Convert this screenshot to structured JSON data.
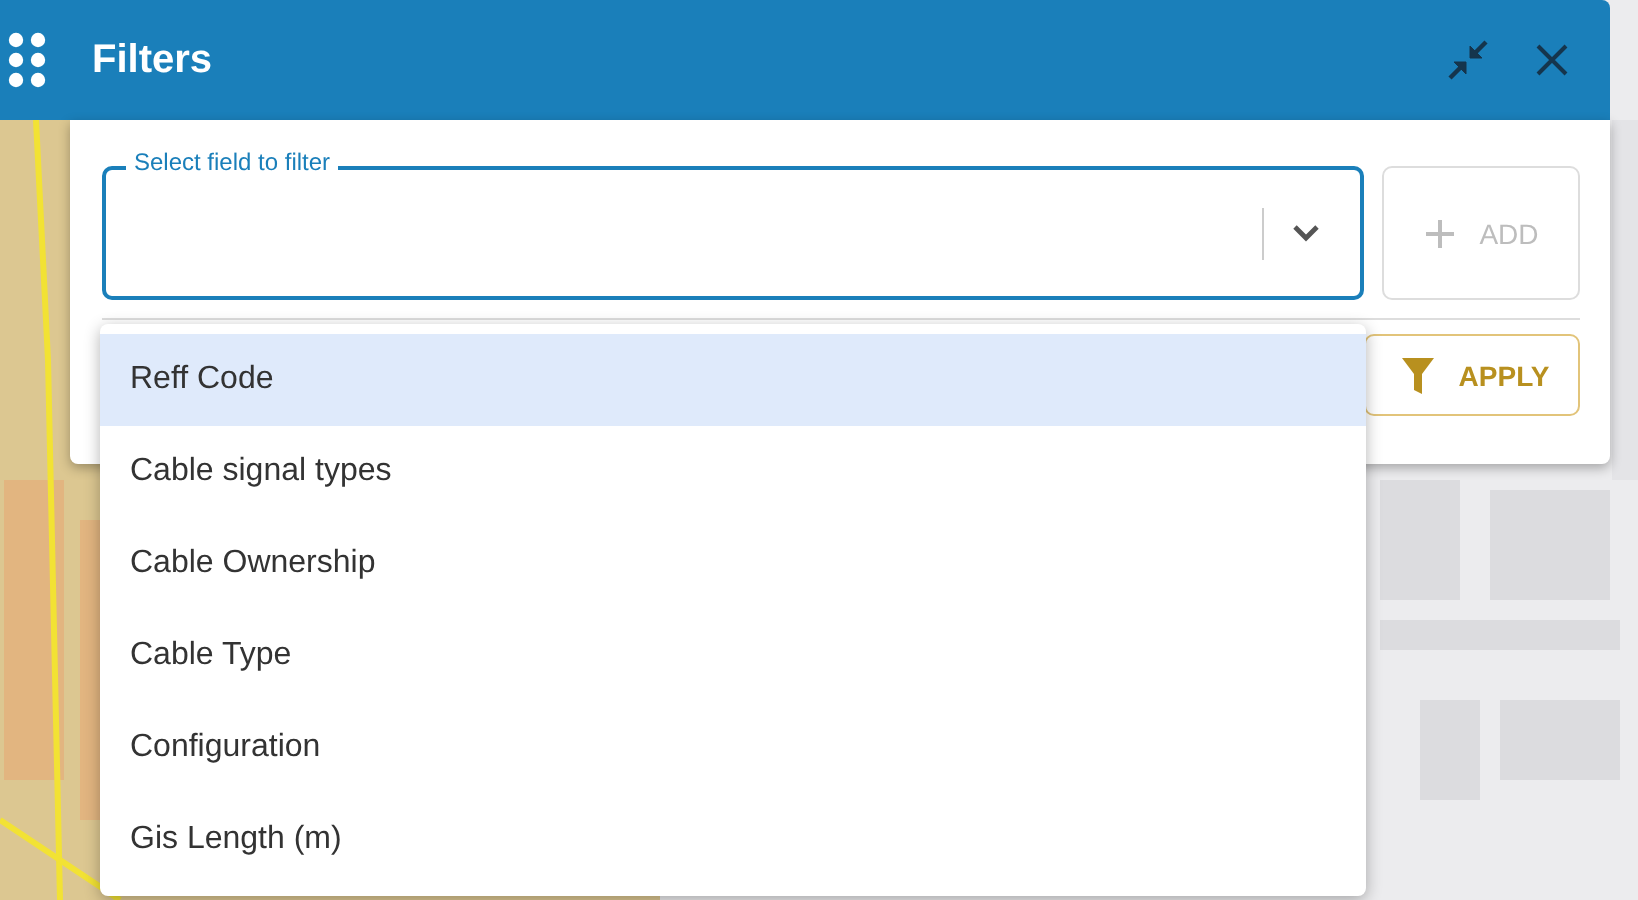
{
  "header": {
    "title": "Filters"
  },
  "field": {
    "label": "Select field to filter"
  },
  "add_button": {
    "label": "ADD",
    "disabled": true
  },
  "apply_button": {
    "label": "APPLY"
  },
  "dropdown": {
    "options": [
      {
        "label": "Reff Code",
        "selected": true
      },
      {
        "label": "Cable signal types",
        "selected": false
      },
      {
        "label": "Cable Ownership",
        "selected": false
      },
      {
        "label": "Cable Type",
        "selected": false
      },
      {
        "label": "Configuration",
        "selected": false
      },
      {
        "label": "Gis Length (m)",
        "selected": false
      }
    ]
  }
}
